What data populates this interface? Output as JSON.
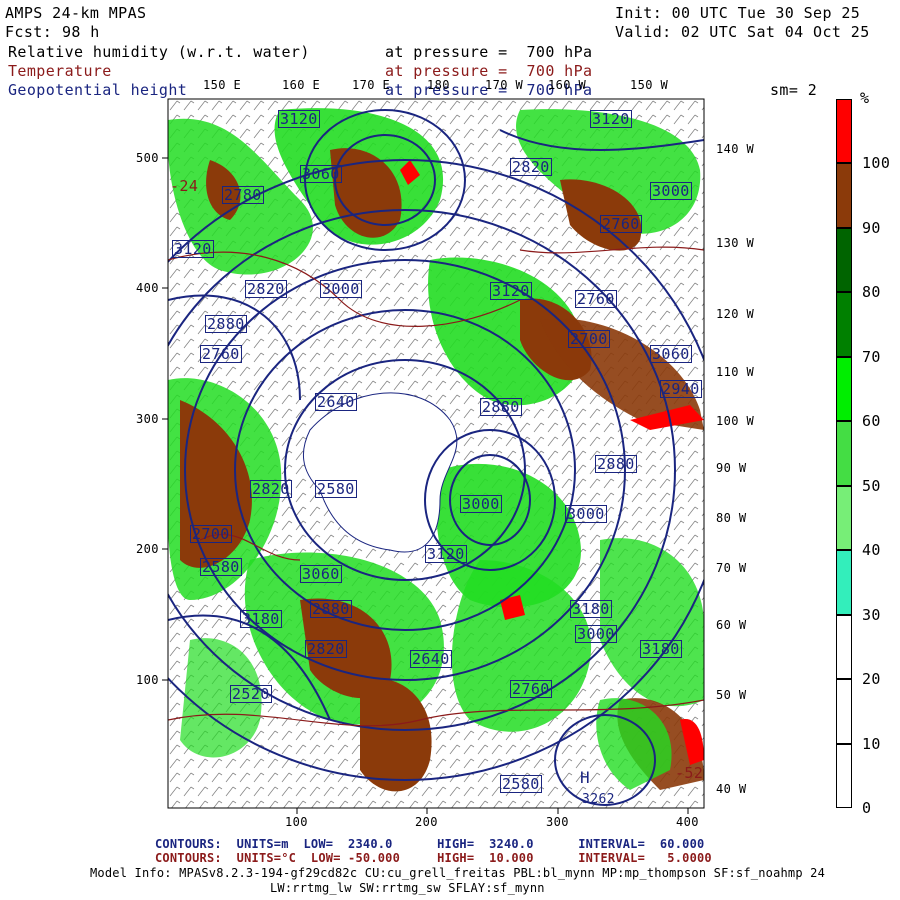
{
  "header": {
    "model": "AMPS 24-km MPAS",
    "forecast_label": "Fcst:",
    "forecast_hours": "98 h",
    "init": "Init: 00 UTC Tue 30 Sep 25",
    "valid": "Valid: 02 UTC Sat 04 Oct 25"
  },
  "fields": [
    {
      "name": "Relative humidity (w.r.t. water)",
      "level": "at pressure =  700 hPa",
      "color": "#000000"
    },
    {
      "name": "Temperature",
      "level": "at pressure =  700 hPa",
      "color": "#8b1a1a"
    },
    {
      "name": "Geopotential height",
      "level": "at pressure =  700 hPa",
      "color": "#1a2580"
    }
  ],
  "smoothing": "sm= 2",
  "colorbar": {
    "unit": "%",
    "labels": [
      "100",
      "90",
      "80",
      "70",
      "60",
      "50",
      "40",
      "30",
      "20",
      "10",
      "0"
    ],
    "bands": [
      {
        "from": 100,
        "to": 110,
        "color": "#ff0000"
      },
      {
        "from": 90,
        "to": 100,
        "color": "#8b3a0a"
      },
      {
        "from": 80,
        "to": 90,
        "color": "#006400"
      },
      {
        "from": 70,
        "to": 80,
        "color": "#008000"
      },
      {
        "from": 60,
        "to": 70,
        "color": "#00ee00"
      },
      {
        "from": 50,
        "to": 60,
        "color": "#44dd44"
      },
      {
        "from": 40,
        "to": 50,
        "color": "#77ee77"
      },
      {
        "from": 30,
        "to": 40,
        "color": "#33eebb"
      },
      {
        "from": 20,
        "to": 30,
        "color": "#ffffff"
      },
      {
        "from": 10,
        "to": 20,
        "color": "#ffffff"
      },
      {
        "from": 0,
        "to": 10,
        "color": "#ffffff"
      }
    ]
  },
  "axes": {
    "x_ticks": [
      "100",
      "200",
      "300",
      "400"
    ],
    "y_ticks": [
      "500",
      "400",
      "300",
      "200",
      "100"
    ],
    "top_lon": [
      "150 E",
      "160 E",
      "170 E",
      "180",
      "170 W",
      "160 W",
      "150 W"
    ],
    "right_lon": [
      "140 W",
      "130 W",
      "120 W",
      "110 W",
      "100 W",
      "90 W",
      "80 W",
      "70 W",
      "60 W",
      "50 W",
      "40 W"
    ]
  },
  "map_labels": {
    "height_labels": [
      "3120",
      "3060",
      "2780",
      "3120",
      "3000",
      "2820",
      "2760",
      "3120",
      "2820",
      "3000",
      "2880",
      "3120",
      "2760",
      "3060",
      "2760",
      "2700",
      "2640",
      "2880",
      "2940",
      "2880",
      "2820",
      "2580",
      "3000",
      "3000",
      "3120",
      "2700",
      "2580",
      "3060",
      "3180",
      "2880",
      "3180",
      "2820",
      "2640",
      "2760",
      "3000",
      "3180",
      "2520",
      "2580"
    ],
    "high_marker": "H",
    "high_value": "3262",
    "cold_labels": [
      "-24",
      "-52"
    ]
  },
  "footer": {
    "contour1": "CONTOURS:  UNITS=m  LOW=  2340.0      HIGH=  3240.0      INTERVAL=  60.000",
    "contour2": "CONTOURS:  UNITS=°C  LOW= -50.000     HIGH=  10.000      INTERVAL=   5.0000",
    "model_info1": "Model Info: MPASv8.2.3-194-gf29cd82c CU:cu_grell_freitas PBL:bl_mynn MP:mp_thompson SF:sf_noahmp 24",
    "model_info2": "LW:rrtmg_lw SW:rrtmg_sw SFLAY:sf_mynn"
  }
}
